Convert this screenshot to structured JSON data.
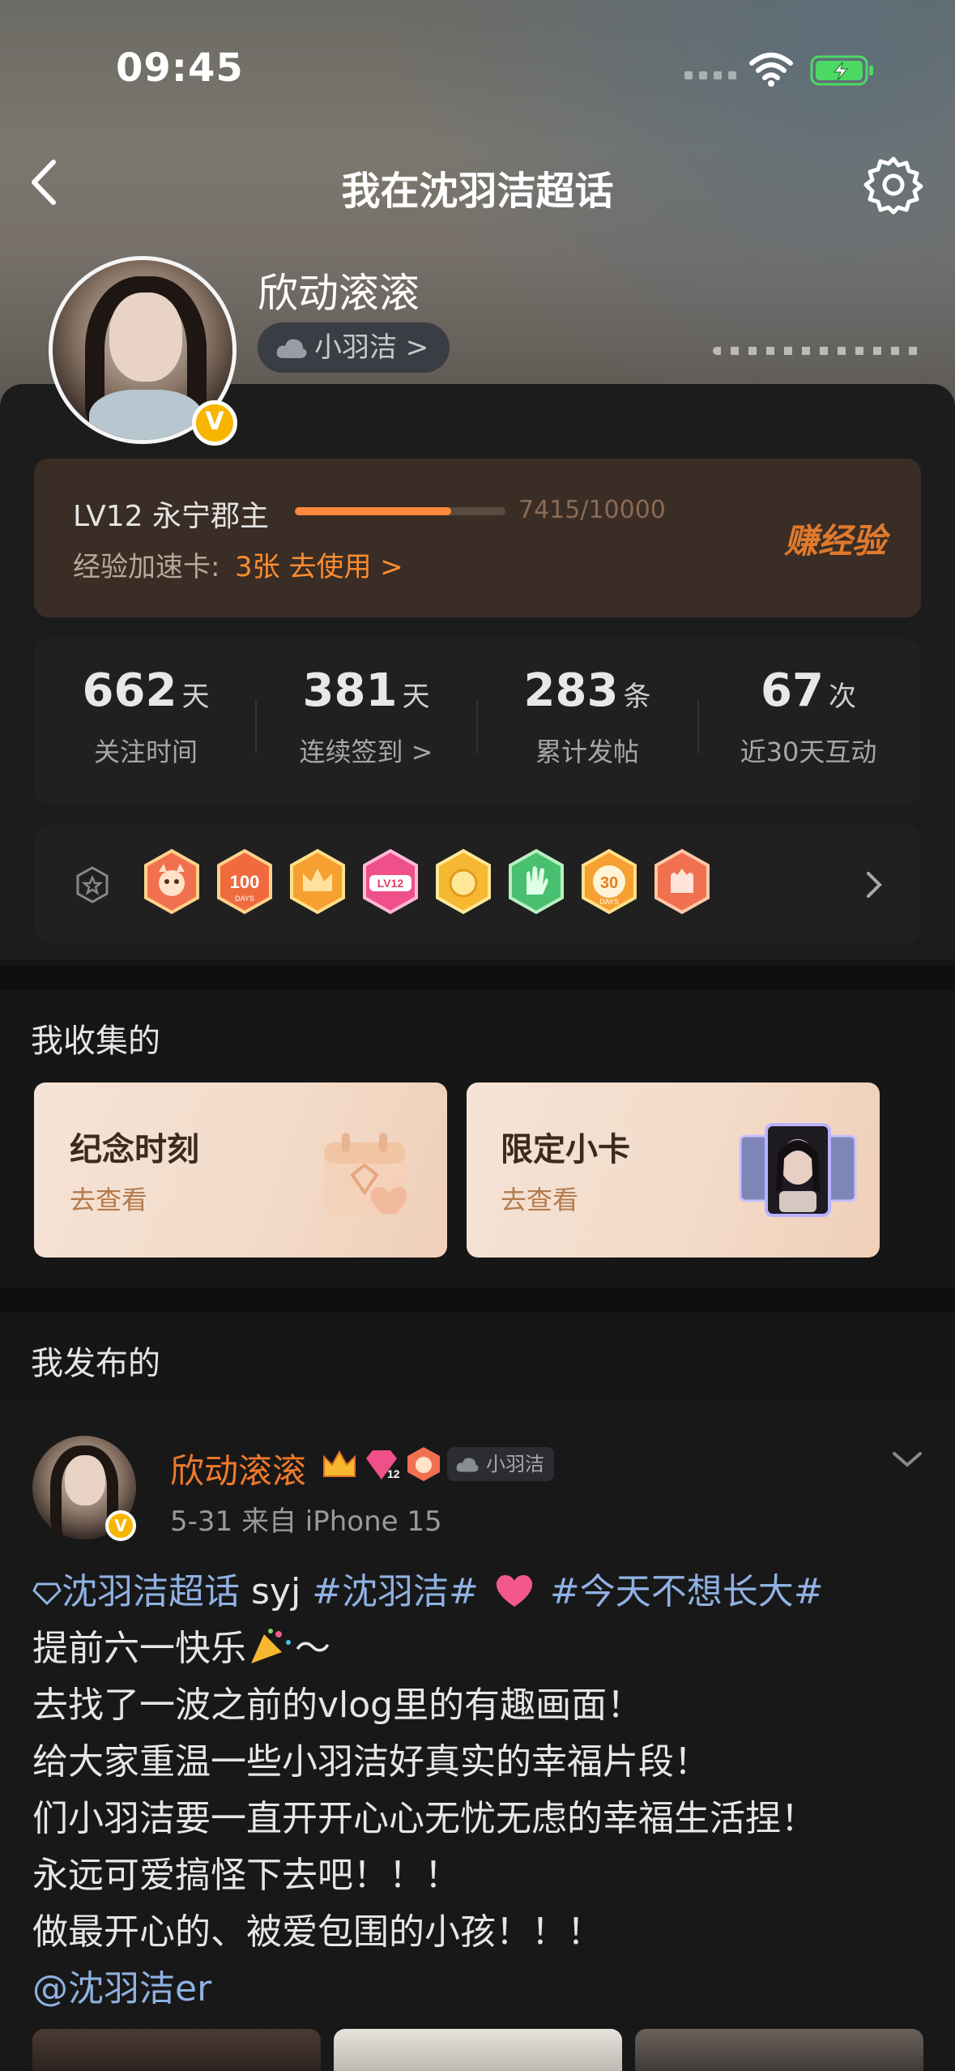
{
  "status_bar": {
    "time": "09:45"
  },
  "nav": {
    "title": "我在沈羽洁超话"
  },
  "profile": {
    "username": "欣动滚滚",
    "tag": "小羽洁 >",
    "verified_mark": "V"
  },
  "level": {
    "name": "LV12 永宁郡主",
    "progress_text": "7415/10000",
    "progress_value": 7415,
    "progress_max": 10000,
    "card_label": "经验加速卡:",
    "card_count": "3张 去使用 >",
    "earn": "赚经验"
  },
  "stats": [
    {
      "value": "662",
      "unit": "天",
      "label": "关注时间"
    },
    {
      "value": "381",
      "unit": "天",
      "label": "连续签到 >"
    },
    {
      "value": "283",
      "unit": "条",
      "label": "累计发帖"
    },
    {
      "value": "67",
      "unit": "次",
      "label": "近30天互动"
    }
  ],
  "badges": {
    "items": [
      "fox-badge",
      "100-days-badge",
      "crown-badge",
      "lv12-badge",
      "coin-badge",
      "hand-badge",
      "30-days-badge",
      "gesture-badge"
    ],
    "colors": [
      "#f07050",
      "#f06a40",
      "#f5a030",
      "#f0508a",
      "#f5b830",
      "#48c070",
      "#f5a030",
      "#f07050"
    ],
    "labels": {
      "b100": "100",
      "b100_sub": "DAYS",
      "lv12": "LV12",
      "b30": "30",
      "b30_sub": "DAYS"
    }
  },
  "collections": {
    "title": "我收集的",
    "items": [
      {
        "title": "纪念时刻",
        "action": "去查看"
      },
      {
        "title": "限定小卡",
        "action": "去查看"
      }
    ]
  },
  "posts_section": {
    "title": "我发布的"
  },
  "post": {
    "author": "欣动滚滚",
    "tag": "小羽洁",
    "meta": "5-31  来自 iPhone 15",
    "lines": {
      "topic": "沈羽洁超话",
      "l1_text": " syj ",
      "l1_hashtag1": "#沈羽洁#",
      "l1_hashtag2": "#今天不想长大#",
      "l2": "提前六一快乐",
      "l2_tail": "～",
      "l3": "去找了一波之前的vlog里的有趣画面！",
      "l4": "给大家重温一些小羽洁好真实的幸福片段！",
      "l5": "们小羽洁要一直开开心心无忧无虑的幸福生活捏！",
      "l6": "永远可爱搞怪下去吧！！！",
      "l7": "做最开心的、被爱包围的小孩！！！",
      "mention": "@沈羽洁er"
    }
  }
}
